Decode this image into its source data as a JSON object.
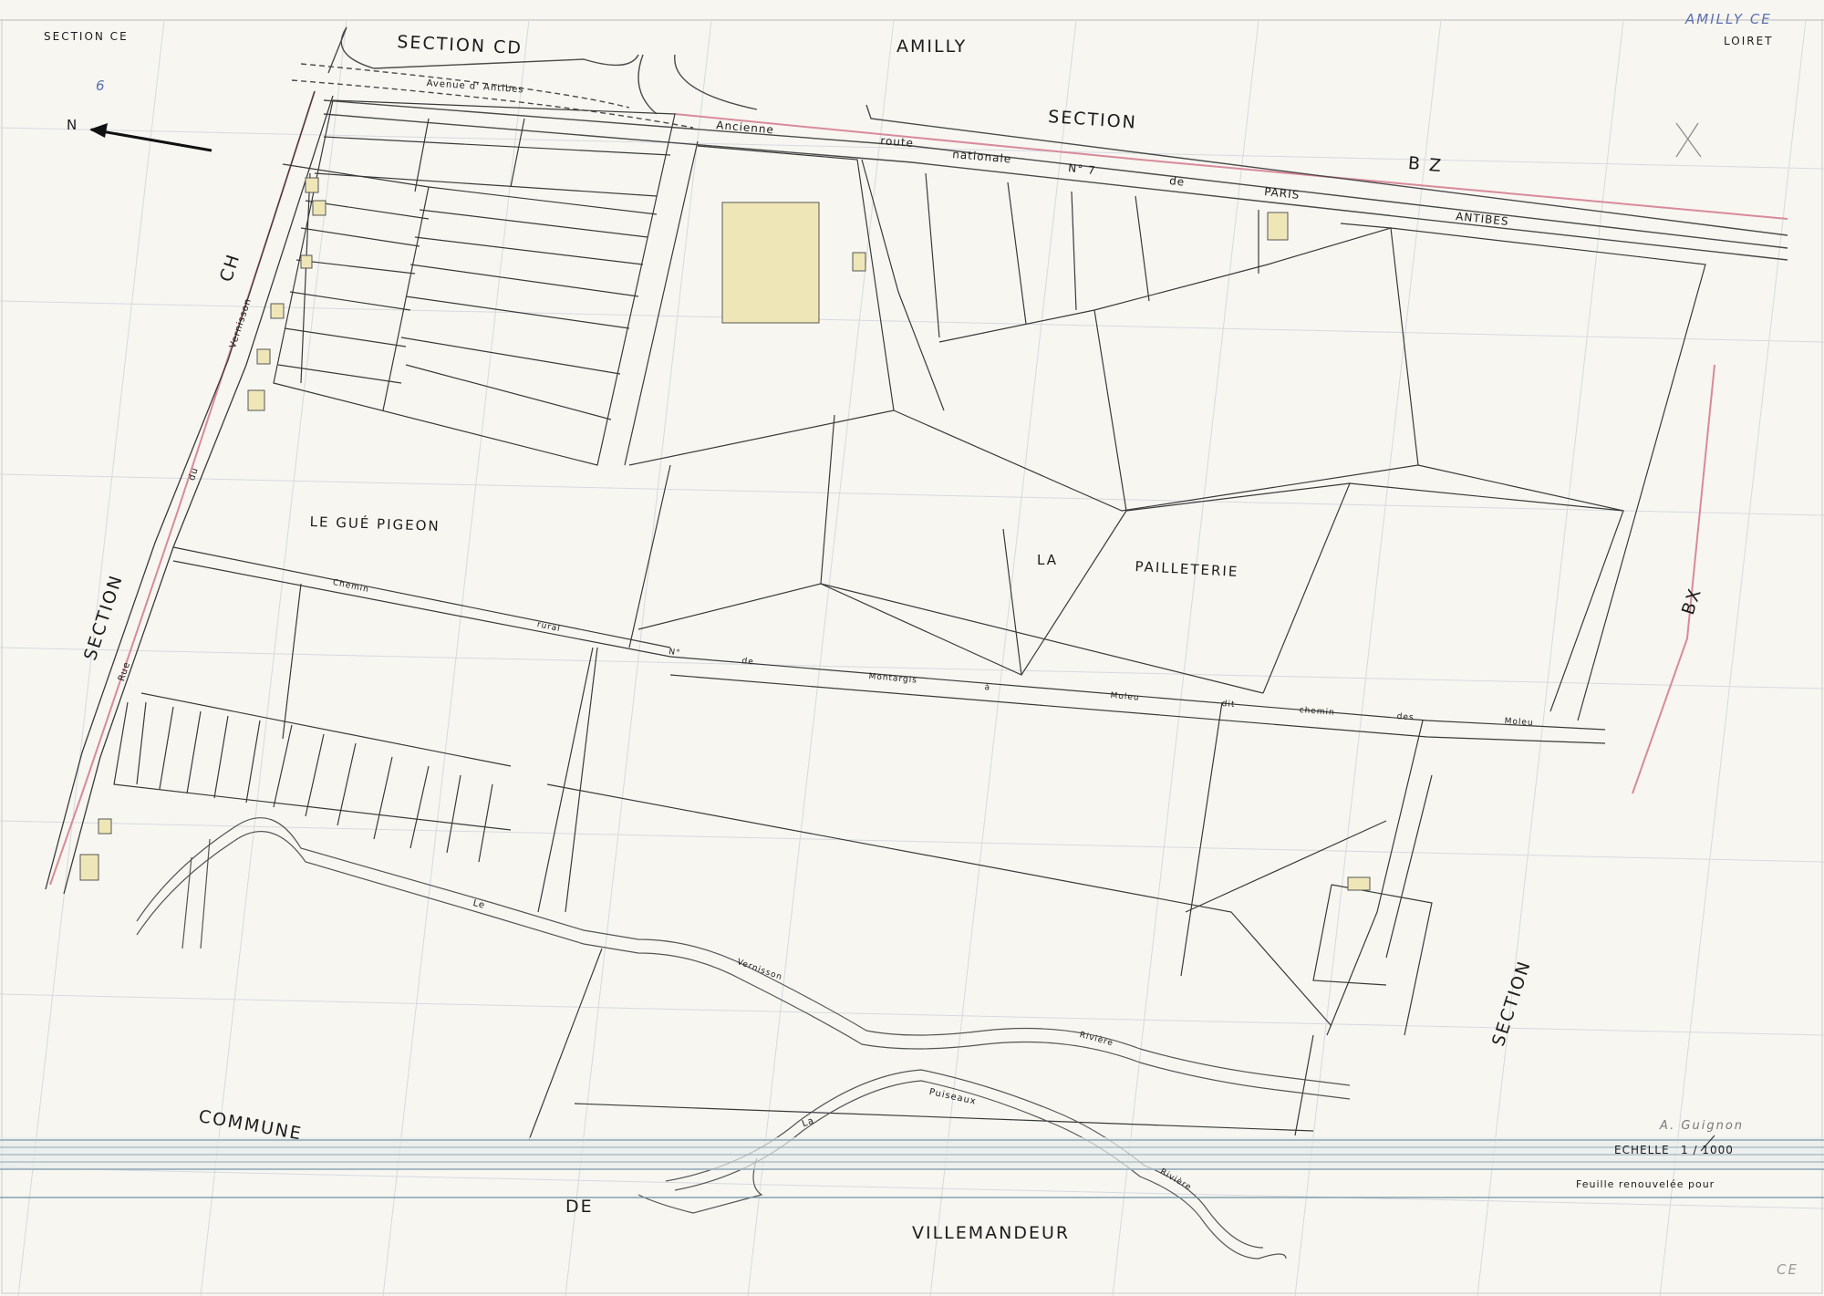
{
  "header": {
    "left_title": "SECTION CE",
    "center_title": "AMILLY",
    "right_department": "LOIRET",
    "stamp_handwritten": "AMILLY CE"
  },
  "sheet_number_handwritten": "6",
  "north_arrow_label": "N",
  "adjacent_sections": {
    "cd": "SECTION     CD",
    "bz_word": "SECTION",
    "bz_code": "B Z",
    "ch_word": "SECTION",
    "ch_code": "CH",
    "bx_word": "SECTION",
    "bx_code": "BX"
  },
  "places": {
    "gue_pigeon": "LE     GUÉ     PIGEON",
    "la": "LA",
    "pailleterie": "PAILLETERIE"
  },
  "road_labels": {
    "ancienne": "Ancienne",
    "route": "route",
    "nationale": "nationale",
    "n7": "N° 7",
    "de": "de",
    "paris": "PARIS",
    "antibes": "ANTIBES",
    "avenue": "Avenue    d' Antibes",
    "chemin": "Chemin",
    "rural": "rural",
    "no": "N°",
    "de2": "de",
    "montargis": "Montargis",
    "a": "à",
    "moleu": "Moleu",
    "dit": "dit",
    "chemin2": "chemin",
    "des": "des",
    "moleu2": "Moleu",
    "rue": "Rue",
    "du": "du",
    "vernisson_canal": "Vernisson",
    "le": "Le",
    "vernisson_riv": "Vernisson",
    "riviere": "Rivière",
    "la_riv": "La",
    "puiseaux": "Puiseaux",
    "riviere2": "Rivière"
  },
  "commune": {
    "w1": "COMMUNE",
    "w2": "DE",
    "w3": "VILLEMANDEUR"
  },
  "scale": {
    "label": "ECHELLE",
    "value": "1 / 1000"
  },
  "renewal": {
    "text": "Feuille  renouvelée  pour"
  },
  "signature_handwritten": "A. Guignon",
  "corner_code": "CE",
  "colors": {
    "paper": "#f7f6f1",
    "line": "#3a3a3a",
    "grid": "#cfd4dc",
    "pink": "#d88a9a",
    "band": "#8fa5b3",
    "building": "#efe6b8"
  }
}
